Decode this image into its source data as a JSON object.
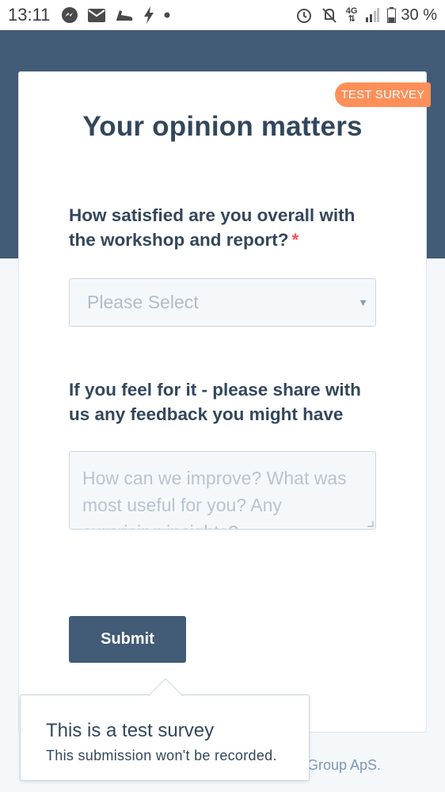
{
  "status_bar": {
    "time": "13:11",
    "left_icons": [
      "messenger-icon",
      "mail-icon",
      "shoe-icon",
      "flash-icon",
      "dot-icon"
    ],
    "right_icons": [
      "alarm-icon",
      "muted-bell-icon",
      "network-4g-icon",
      "signal-icon",
      "battery-icon"
    ],
    "network_label": "4G",
    "battery": "30 %"
  },
  "survey": {
    "badge": "TEST SURVEY",
    "title": "Your opinion matters",
    "question1": {
      "label": "How satisfied are you overall with the workshop and report?",
      "required_marker": "*",
      "placeholder": "Please Select"
    },
    "question2": {
      "label": "If you feel for it - please share with us any feedback you might have",
      "placeholder": "How can we improve? What was most useful for you? Any surprising insights?"
    },
    "submit_label": "Submit"
  },
  "footer": {
    "text": "Group ApS."
  },
  "popup": {
    "title": "This is a test survey",
    "subtitle": "This submission won't be recorded."
  },
  "colors": {
    "header_band": "#425b76",
    "badge": "#ff8f59",
    "submit": "#425b76",
    "required": "#f2545b"
  }
}
